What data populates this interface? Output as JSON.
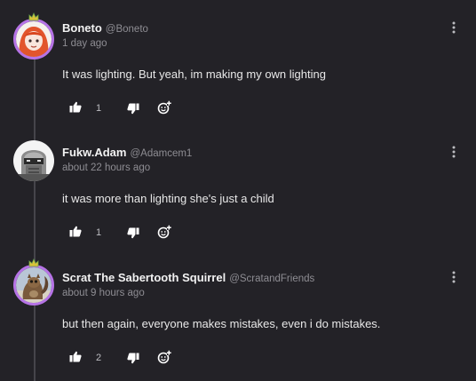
{
  "comments": [
    {
      "author": "Boneto",
      "handle": "@Boneto",
      "time": "1 day ago",
      "text": "It was lighting. But yeah, im making my own lighting",
      "likes": "1",
      "avatar": "orange-haired-girl-avatar",
      "badge": "crown-icon"
    },
    {
      "author": "Fukw.Adam",
      "handle": "@Adamcem1",
      "time": "about 22 hours ago",
      "text": "it was more than lighting she's just a child",
      "likes": "1",
      "avatar": "helmet-robot-avatar"
    },
    {
      "author": "Scrat The Sabertooth Squirrel",
      "handle": "@ScratandFriends",
      "time": "about 9 hours ago",
      "text": "but then again, everyone makes mistakes, even i do mistakes.",
      "likes": "2",
      "avatar": "squirrel-avatar",
      "badge": "crown-icon"
    }
  ],
  "icons": {
    "like": "thumbs-up-icon",
    "dislike": "thumbs-down-icon",
    "emoji": "add-reaction-icon",
    "menu": "more-options-icon"
  },
  "colors": {
    "background": "#232227",
    "thread_line": "#46454b",
    "text": "#e8e8e8",
    "muted": "#8e8d93",
    "ring": "#b673e6"
  }
}
